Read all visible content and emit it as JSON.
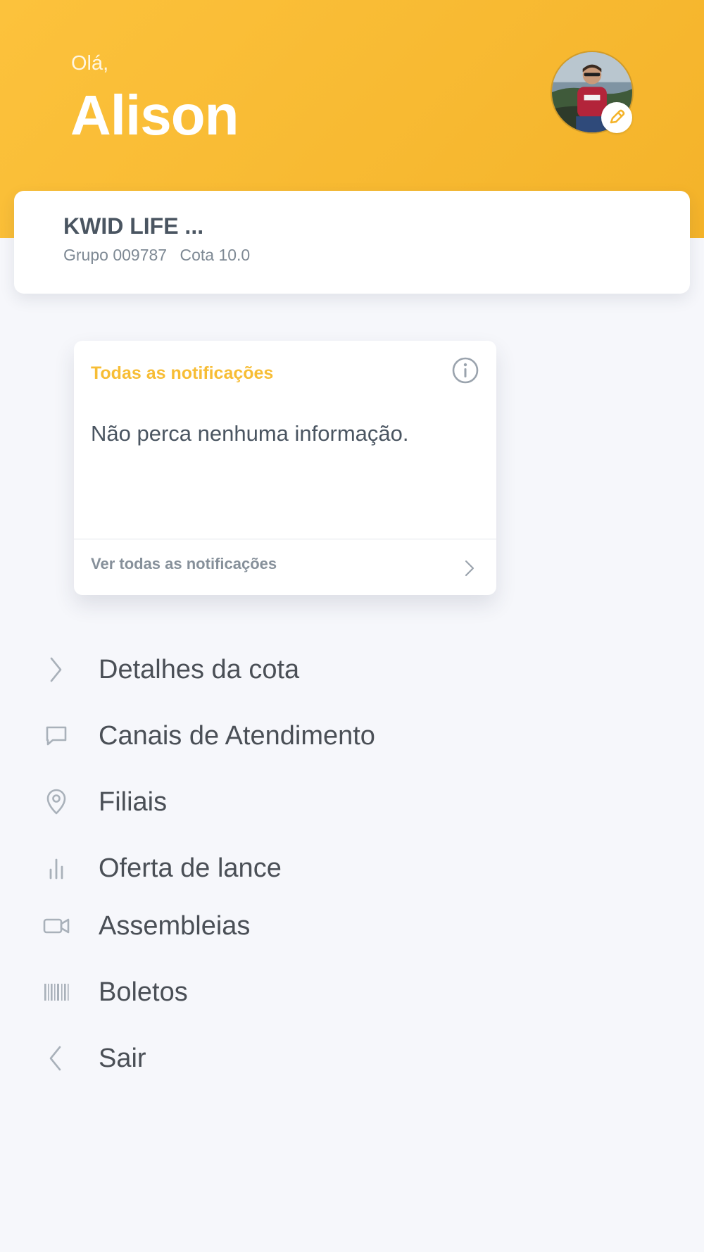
{
  "header": {
    "greeting": "Olá,",
    "name": "Alison",
    "avatar_icon": "avatar-photo",
    "edit_icon": "pencil-icon",
    "accent_color": "#fcc23c"
  },
  "cota": {
    "title": "KWID LIFE ...",
    "group": "Grupo 009787",
    "quota": "Cota 10.0"
  },
  "notifications": {
    "title": "Todas as notificações",
    "info_icon": "info-icon",
    "message": "Não perca nenhuma informação.",
    "link_label": "Ver todas as notificações",
    "link_icon": "chevron-right-icon",
    "title_color": "#f7bd35"
  },
  "menu": {
    "items": [
      {
        "label": "Detalhes da cota",
        "icon": "chevron-right-icon"
      },
      {
        "label": "Canais de Atendimento",
        "icon": "chat-bubble-icon"
      },
      {
        "label": "Filiais",
        "icon": "location-pin-icon"
      },
      {
        "label": "Oferta de lance",
        "icon": "bar-chart-icon"
      },
      {
        "label": "Assembleias",
        "icon": "video-camera-icon"
      },
      {
        "label": "Boletos",
        "icon": "barcode-icon"
      },
      {
        "label": "Sair",
        "icon": "chevron-left-icon"
      }
    ]
  }
}
